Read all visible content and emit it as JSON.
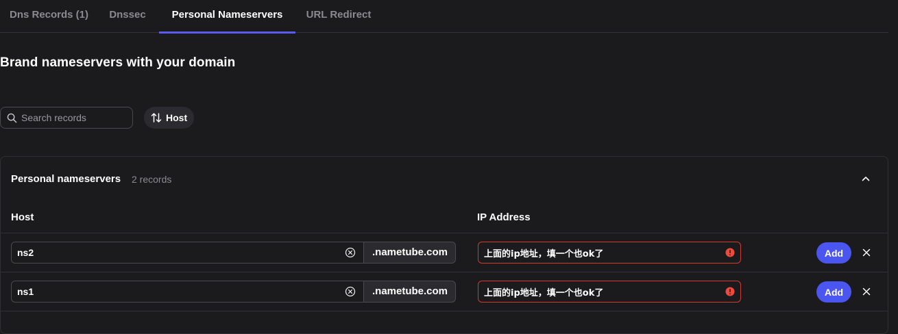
{
  "tabs": [
    {
      "label": "Dns Records (1)"
    },
    {
      "label": "Dnssec"
    },
    {
      "label": "Personal Nameservers"
    },
    {
      "label": "URL Redirect"
    }
  ],
  "active_tab": "Personal Nameservers",
  "heading": "Brand nameservers with your domain",
  "search": {
    "placeholder": "Search records",
    "icon": "search-icon"
  },
  "sort": {
    "label": "Host",
    "icon": "sort-arrows-icon"
  },
  "panel": {
    "title": "Personal nameservers",
    "count": "2 records",
    "collapse_icon": "chevron-up-icon",
    "columns": {
      "host": "Host",
      "ip": "IP Address"
    },
    "rows": [
      {
        "host": "ns2",
        "suffix": ".nametube.com",
        "ip": "上面的ip地址，填一个也ok了",
        "add_label": "Add"
      },
      {
        "host": "ns1",
        "suffix": ".nametube.com",
        "ip": "上面的ip地址，填一个也ok了",
        "add_label": "Add"
      }
    ]
  },
  "colors": {
    "background": "#1b1b1d",
    "accent": "#4b55f0",
    "tab_underline": "#5a5cf0",
    "error": "#d63a2c"
  }
}
